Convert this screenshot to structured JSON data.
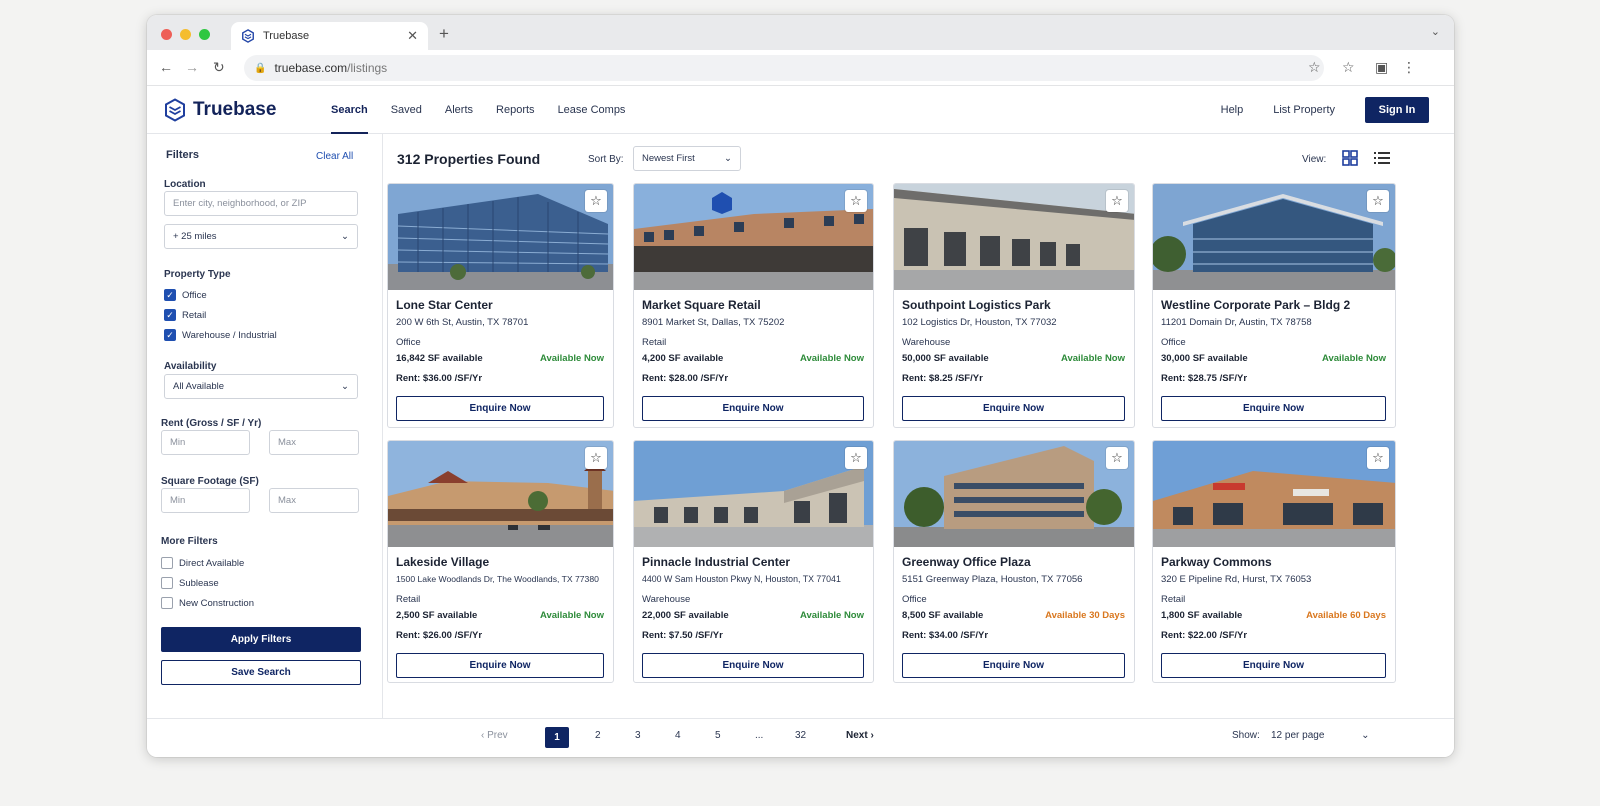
{
  "browser": {
    "tab_title": "Truebase",
    "url_domain": "truebase.com",
    "url_path": "/listings"
  },
  "app": {
    "brand": "Truebase",
    "nav": [
      "Search",
      "Saved",
      "Alerts",
      "Reports",
      "Lease Comps"
    ],
    "active_nav": "Search",
    "help": "Help",
    "list_property": "List Property",
    "sign_in": "Sign In"
  },
  "filters": {
    "title": "Filters",
    "clear_all": "Clear All",
    "location_label": "Location",
    "location_placeholder": "Enter city, neighborhood, or ZIP",
    "radius": "+ 25 miles",
    "property_type_label": "Property Type",
    "property_types": [
      {
        "label": "Office",
        "checked": true
      },
      {
        "label": "Retail",
        "checked": true
      },
      {
        "label": "Warehouse / Industrial",
        "checked": true
      }
    ],
    "availability_label": "Availability",
    "availability_value": "All Available",
    "rent_label": "Rent (Gross / SF / Yr)",
    "sqft_label": "Square Footage (SF)",
    "min_placeholder": "Min",
    "max_placeholder": "Max",
    "more_filters_label": "More Filters",
    "more_filters": [
      {
        "label": "Direct Available",
        "checked": false
      },
      {
        "label": "Sublease",
        "checked": false
      },
      {
        "label": "New Construction",
        "checked": false
      }
    ],
    "apply": "Apply Filters",
    "save_search": "Save Search"
  },
  "results": {
    "count_label": "312 Properties Found",
    "sort_label": "Sort By:",
    "sort_value": "Newest First",
    "view_label": "View:"
  },
  "listings": [
    {
      "name": "Lone Star Center",
      "address": "200 W 6th St, Austin, TX 78701",
      "type": "Office",
      "sf": "16,842 SF available",
      "availability": "Available Now",
      "rent": "Rent: $36.00 /SF/Yr",
      "cta": "Enquire Now"
    },
    {
      "name": "Market Square Retail",
      "address": "8901 Market St, Dallas, TX 75202",
      "type": "Retail",
      "sf": "4,200 SF available",
      "availability": "Available Now",
      "rent": "Rent: $28.00 /SF/Yr",
      "cta": "Enquire Now"
    },
    {
      "name": "Southpoint Logistics Park",
      "address": "102 Logistics Dr, Houston, TX 77032",
      "type": "Warehouse",
      "sf": "50,000 SF available",
      "availability": "Available Now",
      "rent": "Rent: $8.25 /SF/Yr",
      "cta": "Enquire Now"
    },
    {
      "name": "Westline Corporate Park – Bldg 2",
      "address": "11201 Domain Dr, Austin, TX 78758",
      "type": "Office",
      "sf": "30,000 SF available",
      "availability": "Available Now",
      "rent": "Rent: $28.75 /SF/Yr",
      "cta": "Enquire Now"
    },
    {
      "name": "Lakeside Village",
      "address": "1500 Lake Woodlands Dr, The Woodlands, TX 77380",
      "type": "Retail",
      "sf": "2,500 SF available",
      "availability": "Available Now",
      "rent": "Rent: $26.00 /SF/Yr",
      "cta": "Enquire Now"
    },
    {
      "name": "Pinnacle Industrial Center",
      "address": "4400 W Sam Houston Pkwy N, Houston, TX 77041",
      "type": "Warehouse",
      "sf": "22,000 SF available",
      "availability": "Available Now",
      "rent": "Rent: $7.50 /SF/Yr",
      "cta": "Enquire Now"
    },
    {
      "name": "Greenway Office Plaza",
      "address": "5151 Greenway Plaza, Houston, TX 77056",
      "type": "Office",
      "sf": "8,500 SF available",
      "availability": "Available 30 Days",
      "rent": "Rent: $34.00 /SF/Yr",
      "cta": "Enquire Now"
    },
    {
      "name": "Parkway Commons",
      "address": "320 E Pipeline Rd, Hurst, TX 76053",
      "type": "Retail",
      "sf": "1,800 SF available",
      "availability": "Available 60 Days",
      "rent": "Rent: $22.00 /SF/Yr",
      "cta": "Enquire Now"
    }
  ],
  "pagination": {
    "prev": "Prev",
    "pages": [
      "1",
      "2",
      "3",
      "4",
      "5",
      "...",
      "32"
    ],
    "active_page": "1",
    "next": "Next",
    "show_label": "Show:",
    "per_page": "12 per page"
  },
  "colors": {
    "brand_navy": "#0f2563",
    "available_now": "#2e8b3a",
    "available_later": "#d9771e"
  }
}
